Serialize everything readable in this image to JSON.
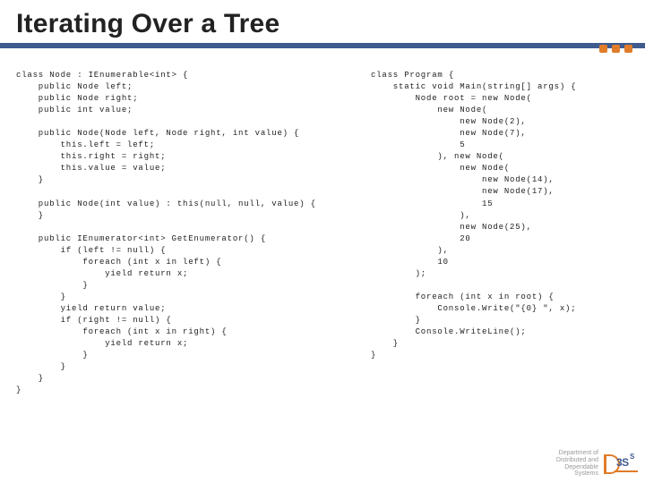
{
  "slide": {
    "title": "Iterating Over a Tree"
  },
  "code": {
    "left": "class Node : IEnumerable<int> {\n    public Node left;\n    public Node right;\n    public int value;\n\n    public Node(Node left, Node right, int value) {\n        this.left = left;\n        this.right = right;\n        this.value = value;\n    }\n\n    public Node(int value) : this(null, null, value) {\n    }\n\n    public IEnumerator<int> GetEnumerator() {\n        if (left != null) {\n            foreach (int x in left) {\n                yield return x;\n            }\n        }\n        yield return value;\n        if (right != null) {\n            foreach (int x in right) {\n                yield return x;\n            }\n        }\n    }\n}",
    "right": "class Program {\n    static void Main(string[] args) {\n        Node root = new Node(\n            new Node(\n                new Node(2),\n                new Node(7),\n                5\n            ), new Node(\n                new Node(\n                    new Node(14),\n                    new Node(17),\n                    15\n                ),\n                new Node(25),\n                20\n            ),\n            10\n        );\n\n        foreach (int x in root) {\n            Console.Write(\"{0} \", x);\n        }\n        Console.WriteLine();\n    }\n}"
  },
  "footer": {
    "dept_line1": "Department of",
    "dept_line2": "Distributed and",
    "dept_line3": "Dependable",
    "dept_line4": "Systems",
    "logo_txt": "3S",
    "logo_sup": "S"
  }
}
